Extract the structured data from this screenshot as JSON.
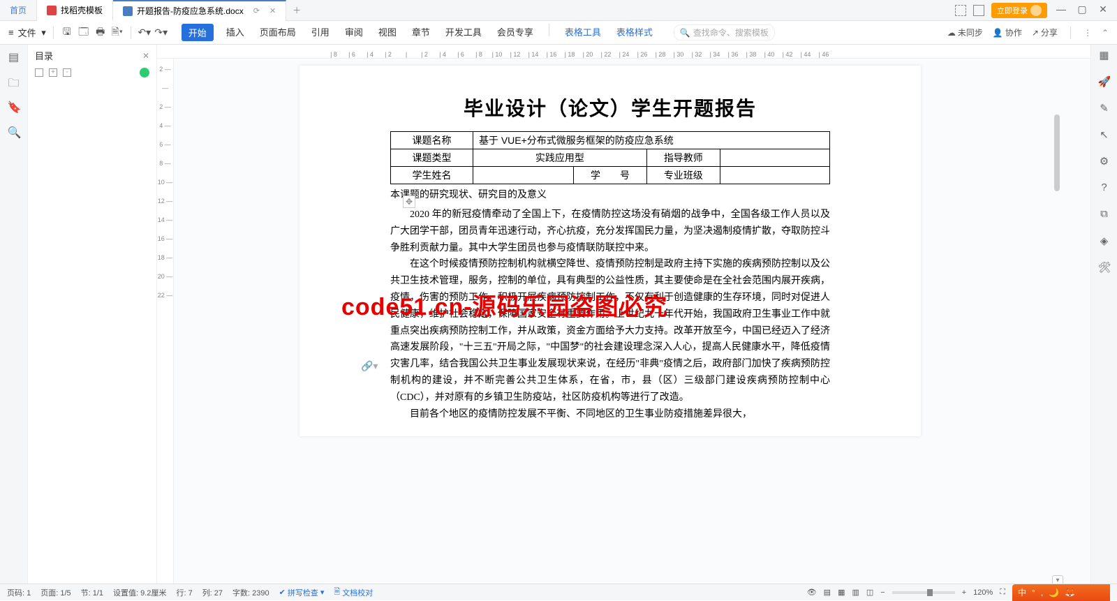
{
  "tabs": {
    "home": "首页",
    "template": "找稻壳模板",
    "active_doc": "开题报告-防疫应急系统.docx"
  },
  "win": {
    "login": "立即登录"
  },
  "toolbar": {
    "file": "文件",
    "menus": [
      "开始",
      "插入",
      "页面布局",
      "引用",
      "审阅",
      "视图",
      "章节",
      "开发工具",
      "会员专享"
    ],
    "extra1": "表格工具",
    "extra2": "表格样式",
    "search_placeholder": "查找命令、搜索模板",
    "sync": "未同步",
    "coop": "协作",
    "share": "分享"
  },
  "outline": {
    "title": "目录"
  },
  "hruler": [
    "8",
    "6",
    "4",
    "2",
    "",
    "2",
    "4",
    "6",
    "8",
    "10",
    "12",
    "14",
    "16",
    "18",
    "20",
    "22",
    "24",
    "26",
    "28",
    "30",
    "32",
    "34",
    "36",
    "38",
    "40",
    "42",
    "44",
    "46"
  ],
  "vruler": [
    "2",
    "",
    "2",
    "4",
    "6",
    "8",
    "10",
    "12",
    "14",
    "16",
    "18",
    "20",
    "22"
  ],
  "doc": {
    "title": "毕业设计（论文）学生开题报告",
    "r1c1": "课题名称",
    "r1c2": "基于 VUE+分布式微服务框架的防疫应急系统",
    "r2c1": "课题类型",
    "r2c2": "实践应用型",
    "r2c3": "指导教师",
    "r3c1": "学生姓名",
    "r3c2": "学　　号",
    "r3c3": "专业班级",
    "section": "本课题的研究现状、研究目的及意义",
    "p1": "2020 年的新冠疫情牵动了全国上下，在疫情防控这场没有硝烟的战争中，全国各级工作人员以及广大团学干部，团员青年迅速行动，齐心抗疫，充分发挥国民力量，为坚决遏制疫情扩散，夺取防控斗争胜利贡献力量。其中大学生团员也参与疫情联防联控中来。",
    "p2": "在这个时候疫情预防控制机构就横空降世、疫情预防控制是政府主持下实施的疾病预防控制以及公共卫生技术管理，服务，控制的单位，具有典型的公益性质，其主要使命是在全社会范围内展开疾病，疫情，伤害的预防工作，积极开展疾病预防控制工作，不仅有利于创造健康的生存环境，同时对促进人民健康，维护社会稳定，保障国家安全有重要作用。上世纪九十年代开始，我国政府卫生事业工作中就重点突出疾病预防控制工作，并从政策，资金方面给予大力支持。改革开放至今，中国已经迈入了经济高速发展阶段，\"十三五\"开局之际，\"中国梦\"的社会建设理念深入人心，提高人民健康水平，降低疫情灾害几率，结合我国公共卫生事业发展现状来说，在经历\"非典\"疫情之后，政府部门加快了疾病预防控制机构的建设，并不断完善公共卫生体系，在省，市，县（区）三级部门建设疾病预防控制中心（CDC），并对原有的乡镇卫生防疫站，社区防疫机构等进行了改造。",
    "p3": "目前各个地区的疫情防控发展不平衡、不同地区的卫生事业防疫措施差异很大，"
  },
  "watermark": "code51.cn-源码乐园盗图必究",
  "status": {
    "page_no": "页码: 1",
    "page": "页面: 1/5",
    "section": "节: 1/1",
    "pos": "设置值: 9.2厘米",
    "row": "行: 7",
    "col": "列: 27",
    "words": "字数: 2390",
    "spell": "拼写检查",
    "archive": "文档校对",
    "zoom": "120%"
  },
  "ime": {
    "lang": "中"
  }
}
